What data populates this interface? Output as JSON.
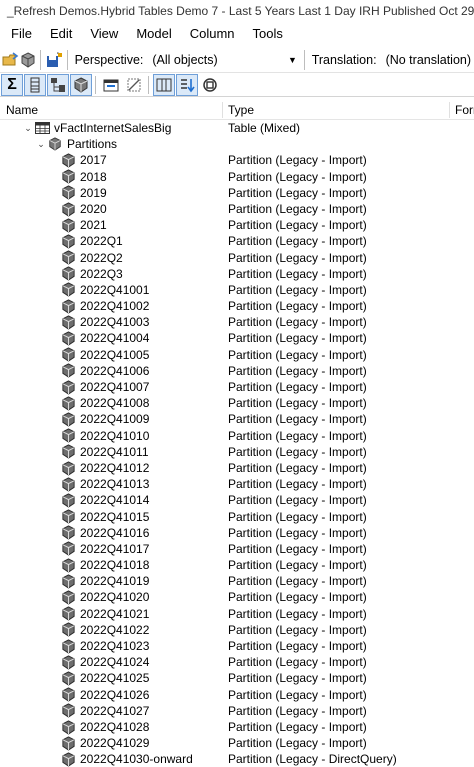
{
  "window": {
    "title": "_Refresh Demos.Hybrid Tables Demo 7 - Last 5 Years Last 1 Day IRH Published Oct 29"
  },
  "menu": [
    "File",
    "Edit",
    "View",
    "Model",
    "Column",
    "Tools"
  ],
  "toolbar": {
    "perspective_label": "Perspective:",
    "perspective_value": "(All objects)",
    "translation_label": "Translation:",
    "translation_value": "(No translation)"
  },
  "columns": {
    "name": "Name",
    "type": "Type",
    "format": "Form"
  },
  "tree": {
    "table": {
      "name": "vFactInternetSalesBig",
      "type": "Table (Mixed)"
    },
    "folder": {
      "name": "Partitions"
    },
    "partitions": [
      {
        "name": "2017",
        "type": "Partition (Legacy - Import)"
      },
      {
        "name": "2018",
        "type": "Partition (Legacy - Import)"
      },
      {
        "name": "2019",
        "type": "Partition (Legacy - Import)"
      },
      {
        "name": "2020",
        "type": "Partition (Legacy - Import)"
      },
      {
        "name": "2021",
        "type": "Partition (Legacy - Import)"
      },
      {
        "name": "2022Q1",
        "type": "Partition (Legacy - Import)"
      },
      {
        "name": "2022Q2",
        "type": "Partition (Legacy - Import)"
      },
      {
        "name": "2022Q3",
        "type": "Partition (Legacy - Import)"
      },
      {
        "name": "2022Q41001",
        "type": "Partition (Legacy - Import)"
      },
      {
        "name": "2022Q41002",
        "type": "Partition (Legacy - Import)"
      },
      {
        "name": "2022Q41003",
        "type": "Partition (Legacy - Import)"
      },
      {
        "name": "2022Q41004",
        "type": "Partition (Legacy - Import)"
      },
      {
        "name": "2022Q41005",
        "type": "Partition (Legacy - Import)"
      },
      {
        "name": "2022Q41006",
        "type": "Partition (Legacy - Import)"
      },
      {
        "name": "2022Q41007",
        "type": "Partition (Legacy - Import)"
      },
      {
        "name": "2022Q41008",
        "type": "Partition (Legacy - Import)"
      },
      {
        "name": "2022Q41009",
        "type": "Partition (Legacy - Import)"
      },
      {
        "name": "2022Q41010",
        "type": "Partition (Legacy - Import)"
      },
      {
        "name": "2022Q41011",
        "type": "Partition (Legacy - Import)"
      },
      {
        "name": "2022Q41012",
        "type": "Partition (Legacy - Import)"
      },
      {
        "name": "2022Q41013",
        "type": "Partition (Legacy - Import)"
      },
      {
        "name": "2022Q41014",
        "type": "Partition (Legacy - Import)"
      },
      {
        "name": "2022Q41015",
        "type": "Partition (Legacy - Import)"
      },
      {
        "name": "2022Q41016",
        "type": "Partition (Legacy - Import)"
      },
      {
        "name": "2022Q41017",
        "type": "Partition (Legacy - Import)"
      },
      {
        "name": "2022Q41018",
        "type": "Partition (Legacy - Import)"
      },
      {
        "name": "2022Q41019",
        "type": "Partition (Legacy - Import)"
      },
      {
        "name": "2022Q41020",
        "type": "Partition (Legacy - Import)"
      },
      {
        "name": "2022Q41021",
        "type": "Partition (Legacy - Import)"
      },
      {
        "name": "2022Q41022",
        "type": "Partition (Legacy - Import)"
      },
      {
        "name": "2022Q41023",
        "type": "Partition (Legacy - Import)"
      },
      {
        "name": "2022Q41024",
        "type": "Partition (Legacy - Import)"
      },
      {
        "name": "2022Q41025",
        "type": "Partition (Legacy - Import)"
      },
      {
        "name": "2022Q41026",
        "type": "Partition (Legacy - Import)"
      },
      {
        "name": "2022Q41027",
        "type": "Partition (Legacy - Import)"
      },
      {
        "name": "2022Q41028",
        "type": "Partition (Legacy - Import)"
      },
      {
        "name": "2022Q41029",
        "type": "Partition (Legacy - Import)"
      },
      {
        "name": "2022Q41030-onward",
        "type": "Partition (Legacy - DirectQuery)"
      }
    ]
  },
  "icons": {
    "app": "tabular-editor-icon",
    "table": "table-grid-icon",
    "partition": "partition-cube-icon"
  },
  "colors": {
    "selected_toggle_border": "#6f9fd8",
    "selected_toggle_bg": "#dbe9f8"
  }
}
